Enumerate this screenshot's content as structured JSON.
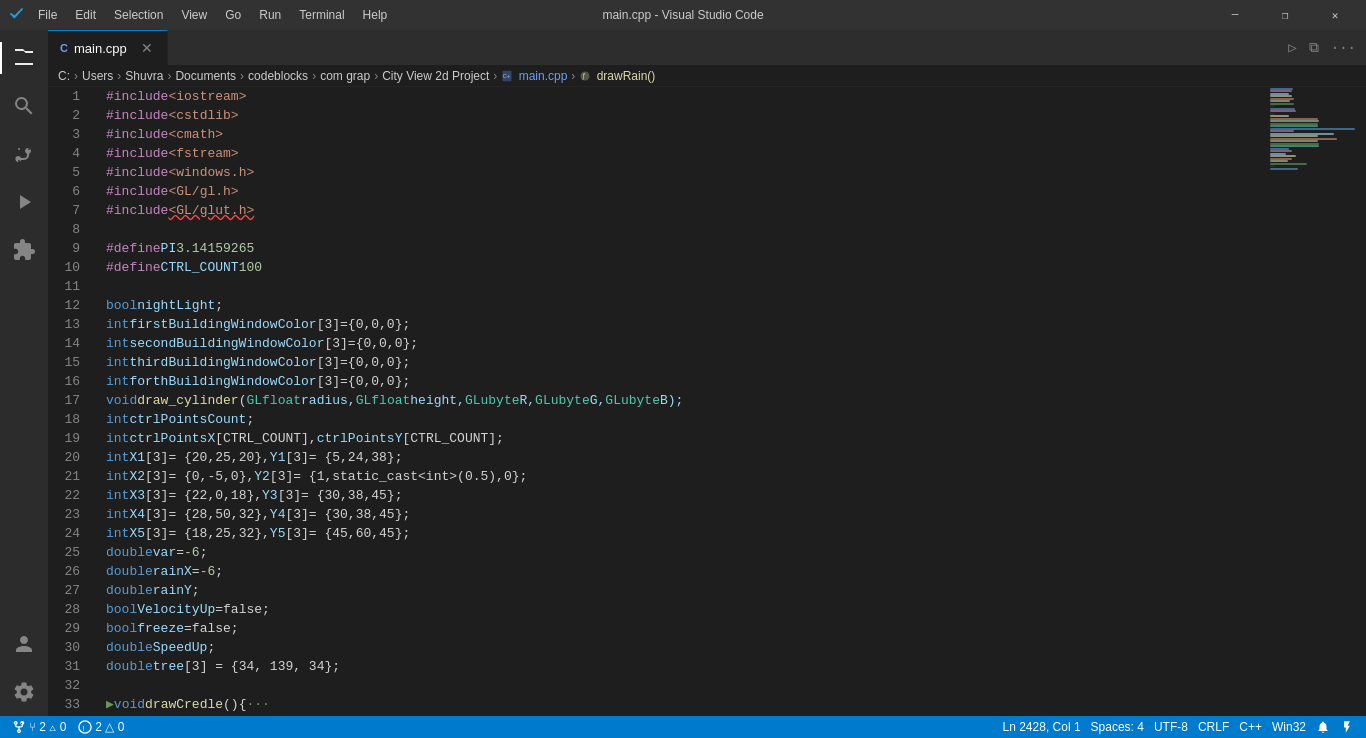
{
  "titleBar": {
    "menus": [
      "File",
      "Edit",
      "Selection",
      "View",
      "Go",
      "Run",
      "Terminal",
      "Help"
    ],
    "title": "main.cpp - Visual Studio Code",
    "controls": {
      "minimize": "─",
      "restore": "❐",
      "close": "✕"
    }
  },
  "activityBar": {
    "icons": [
      {
        "name": "explorer-icon",
        "symbol": "⎇",
        "label": "Explorer",
        "active": true
      },
      {
        "name": "search-icon",
        "symbol": "🔍",
        "label": "Search",
        "active": false
      },
      {
        "name": "source-control-icon",
        "symbol": "⑂",
        "label": "Source Control",
        "active": false
      },
      {
        "name": "run-icon",
        "symbol": "▷",
        "label": "Run",
        "active": false
      },
      {
        "name": "extensions-icon",
        "symbol": "⊞",
        "label": "Extensions",
        "active": false
      }
    ],
    "bottomIcons": [
      {
        "name": "account-icon",
        "symbol": "👤",
        "label": "Account"
      },
      {
        "name": "settings-icon",
        "symbol": "⚙",
        "label": "Settings"
      }
    ]
  },
  "tabs": [
    {
      "label": "main.cpp",
      "icon": "C++-file",
      "active": true,
      "modified": false
    }
  ],
  "tabActions": [
    {
      "name": "run-button",
      "symbol": "▷"
    },
    {
      "name": "split-editor-button",
      "symbol": "⧉"
    },
    {
      "name": "more-actions-button",
      "symbol": "···"
    }
  ],
  "breadcrumb": [
    {
      "text": "C:",
      "type": "normal"
    },
    {
      "text": ">",
      "type": "sep"
    },
    {
      "text": "Users",
      "type": "normal"
    },
    {
      "text": ">",
      "type": "sep"
    },
    {
      "text": "Shuvra",
      "type": "normal"
    },
    {
      "text": ">",
      "type": "sep"
    },
    {
      "text": "Documents",
      "type": "normal"
    },
    {
      "text": ">",
      "type": "sep"
    },
    {
      "text": "codeblocks",
      "type": "normal"
    },
    {
      "text": ">",
      "type": "sep"
    },
    {
      "text": "com grap",
      "type": "normal"
    },
    {
      "text": ">",
      "type": "sep"
    },
    {
      "text": "City View 2d Project",
      "type": "normal"
    },
    {
      "text": ">",
      "type": "sep"
    },
    {
      "text": "main.cpp",
      "type": "file"
    },
    {
      "text": ">",
      "type": "sep"
    },
    {
      "text": "drawRain()",
      "type": "func"
    }
  ],
  "codeLines": [
    {
      "num": 1,
      "tokens": [
        {
          "t": "#include ",
          "c": "kw-include"
        },
        {
          "t": "<iostream>",
          "c": "str-include"
        }
      ]
    },
    {
      "num": 2,
      "tokens": [
        {
          "t": "#include ",
          "c": "kw-include"
        },
        {
          "t": "<cstdlib>",
          "c": "str-include"
        }
      ]
    },
    {
      "num": 3,
      "tokens": [
        {
          "t": "#include ",
          "c": "kw-include"
        },
        {
          "t": "<cmath>",
          "c": "str-include"
        }
      ]
    },
    {
      "num": 4,
      "tokens": [
        {
          "t": "#include ",
          "c": "kw-include"
        },
        {
          "t": "<fstream>",
          "c": "str-include"
        }
      ]
    },
    {
      "num": 5,
      "tokens": [
        {
          "t": "#include ",
          "c": "kw-include"
        },
        {
          "t": "<windows.h>",
          "c": "str-include"
        }
      ]
    },
    {
      "num": 6,
      "tokens": [
        {
          "t": "#include",
          "c": "kw-include"
        },
        {
          "t": "<GL/gl.h>",
          "c": "str-include"
        }
      ]
    },
    {
      "num": 7,
      "tokens": [
        {
          "t": "#include ",
          "c": "kw-include"
        },
        {
          "t": "<GL/glut.h>",
          "c": "str-include squiggly"
        }
      ]
    },
    {
      "num": 8,
      "tokens": []
    },
    {
      "num": 9,
      "tokens": [
        {
          "t": "#define ",
          "c": "kw-define"
        },
        {
          "t": "PI ",
          "c": "macro-name"
        },
        {
          "t": "3.14159265",
          "c": "macro-val"
        }
      ]
    },
    {
      "num": 10,
      "tokens": [
        {
          "t": "#define ",
          "c": "kw-define"
        },
        {
          "t": "CTRL_COUNT ",
          "c": "macro-name"
        },
        {
          "t": "100",
          "c": "macro-val"
        }
      ]
    },
    {
      "num": 11,
      "tokens": []
    },
    {
      "num": 12,
      "tokens": [
        {
          "t": "bool ",
          "c": "kw-bool"
        },
        {
          "t": "nightLight",
          "c": "var-name"
        },
        {
          "t": ";",
          "c": "punct"
        }
      ]
    },
    {
      "num": 13,
      "tokens": [
        {
          "t": "int ",
          "c": "kw-int"
        },
        {
          "t": "firstBuildingWindowColor",
          "c": "var-name"
        },
        {
          "t": "[3]={0,0,0};",
          "c": "punct"
        }
      ]
    },
    {
      "num": 14,
      "tokens": [
        {
          "t": "int ",
          "c": "kw-int"
        },
        {
          "t": "secondBuildingWindowColor",
          "c": "var-name"
        },
        {
          "t": "[3]={0,0,0};",
          "c": "punct"
        }
      ]
    },
    {
      "num": 15,
      "tokens": [
        {
          "t": "int ",
          "c": "kw-int"
        },
        {
          "t": "thirdBuildingWindowColor",
          "c": "var-name"
        },
        {
          "t": "[3]={0,0,0};",
          "c": "punct"
        }
      ]
    },
    {
      "num": 16,
      "tokens": [
        {
          "t": "int ",
          "c": "kw-int"
        },
        {
          "t": "forthBuildingWindowColor",
          "c": "var-name"
        },
        {
          "t": "[3]={0,0,0};",
          "c": "punct"
        }
      ]
    },
    {
      "num": 17,
      "tokens": [
        {
          "t": "void ",
          "c": "kw-void"
        },
        {
          "t": "draw_cylinder",
          "c": "func-name"
        },
        {
          "t": "(",
          "c": "punct"
        },
        {
          "t": "GLfloat ",
          "c": "param-type"
        },
        {
          "t": "radius, ",
          "c": "var-name"
        },
        {
          "t": "GLfloat ",
          "c": "param-type"
        },
        {
          "t": "height, ",
          "c": "var-name"
        },
        {
          "t": "GLubyte ",
          "c": "param-type"
        },
        {
          "t": "R, ",
          "c": "var-name"
        },
        {
          "t": "GLubyte ",
          "c": "param-type"
        },
        {
          "t": "G, ",
          "c": "var-name"
        },
        {
          "t": "GLubyte ",
          "c": "param-type"
        },
        {
          "t": "B);",
          "c": "var-name"
        }
      ]
    },
    {
      "num": 18,
      "tokens": [
        {
          "t": "int ",
          "c": "kw-int"
        },
        {
          "t": "ctrlPointsCount",
          "c": "var-name"
        },
        {
          "t": ";",
          "c": "punct"
        }
      ]
    },
    {
      "num": 19,
      "tokens": [
        {
          "t": "int ",
          "c": "kw-int"
        },
        {
          "t": "ctrlPointsX",
          "c": "var-name"
        },
        {
          "t": "[CTRL_COUNT], ",
          "c": "punct"
        },
        {
          "t": "ctrlPointsY",
          "c": "var-name"
        },
        {
          "t": "[CTRL_COUNT];",
          "c": "punct"
        }
      ]
    },
    {
      "num": 20,
      "tokens": [
        {
          "t": "int ",
          "c": "kw-int"
        },
        {
          "t": "X1",
          "c": "var-name"
        },
        {
          "t": "[3]= {20,25,20}, ",
          "c": "punct"
        },
        {
          "t": "Y1",
          "c": "var-name"
        },
        {
          "t": "[3]= {5,24,38};",
          "c": "punct"
        }
      ]
    },
    {
      "num": 21,
      "tokens": [
        {
          "t": "int ",
          "c": "kw-int"
        },
        {
          "t": "X2",
          "c": "var-name"
        },
        {
          "t": "[3]= {0,-5,0}, ",
          "c": "punct"
        },
        {
          "t": "Y2",
          "c": "var-name"
        },
        {
          "t": "[3]= {1,static_cast<int>(0.5),0};",
          "c": "punct"
        }
      ]
    },
    {
      "num": 22,
      "tokens": [
        {
          "t": "int ",
          "c": "kw-int"
        },
        {
          "t": "X3",
          "c": "var-name"
        },
        {
          "t": "[3]= {22,0,18}, ",
          "c": "punct"
        },
        {
          "t": "Y3",
          "c": "var-name"
        },
        {
          "t": "[3]= {30,38,45};",
          "c": "punct"
        }
      ]
    },
    {
      "num": 23,
      "tokens": [
        {
          "t": "int ",
          "c": "kw-int"
        },
        {
          "t": "X4",
          "c": "var-name"
        },
        {
          "t": "[3]= {28,50,32}, ",
          "c": "punct"
        },
        {
          "t": "Y4",
          "c": "var-name"
        },
        {
          "t": "[3]= {30,38,45};",
          "c": "punct"
        }
      ]
    },
    {
      "num": 24,
      "tokens": [
        {
          "t": "int ",
          "c": "kw-int"
        },
        {
          "t": "X5",
          "c": "var-name"
        },
        {
          "t": "[3]= {18,25,32}, ",
          "c": "punct"
        },
        {
          "t": "Y5",
          "c": "var-name"
        },
        {
          "t": "[3]= {45,60,45};",
          "c": "punct"
        }
      ]
    },
    {
      "num": 25,
      "tokens": [
        {
          "t": "double ",
          "c": "kw-double"
        },
        {
          "t": "var",
          "c": "var-name"
        },
        {
          "t": " = ",
          "c": "op"
        },
        {
          "t": "-6",
          "c": "num-val"
        },
        {
          "t": ";",
          "c": "punct"
        }
      ]
    },
    {
      "num": 26,
      "tokens": [
        {
          "t": "double ",
          "c": "kw-double"
        },
        {
          "t": "rainX",
          "c": "var-name"
        },
        {
          "t": " = ",
          "c": "op"
        },
        {
          "t": "-6",
          "c": "num-val"
        },
        {
          "t": ";",
          "c": "punct"
        }
      ]
    },
    {
      "num": 27,
      "tokens": [
        {
          "t": "double ",
          "c": "kw-double"
        },
        {
          "t": "rainY",
          "c": "var-name"
        },
        {
          "t": ";",
          "c": "punct"
        }
      ]
    },
    {
      "num": 28,
      "tokens": [
        {
          "t": "bool ",
          "c": "kw-bool"
        },
        {
          "t": "VelocityUp",
          "c": "var-name"
        },
        {
          "t": "=false;",
          "c": "punct"
        }
      ]
    },
    {
      "num": 29,
      "tokens": [
        {
          "t": "bool ",
          "c": "kw-bool"
        },
        {
          "t": "freeze",
          "c": "var-name"
        },
        {
          "t": "=false;",
          "c": "punct"
        }
      ]
    },
    {
      "num": 30,
      "tokens": [
        {
          "t": "double ",
          "c": "kw-double"
        },
        {
          "t": "SpeedUp",
          "c": "var-name"
        },
        {
          "t": ";",
          "c": "punct"
        }
      ]
    },
    {
      "num": 31,
      "tokens": [
        {
          "t": "double ",
          "c": "kw-double"
        },
        {
          "t": "tree",
          "c": "var-name"
        },
        {
          "t": "[3] = {34, 139, 34};",
          "c": "punct"
        }
      ]
    },
    {
      "num": 32,
      "tokens": []
    },
    {
      "num": 33,
      "tokens": [
        {
          "t": "▶ ",
          "c": "comment"
        },
        {
          "t": "void ",
          "c": "kw-void"
        },
        {
          "t": "drawCredle",
          "c": "func-name"
        },
        {
          "t": "(){",
          "c": "punct"
        },
        {
          "t": "···",
          "c": "comment"
        }
      ],
      "collapsed": true
    }
  ],
  "statusBar": {
    "left": [
      {
        "name": "git-branch",
        "text": "⑂ 2 △ 0"
      },
      {
        "name": "errors",
        "text": "⚠ 2 △ 0"
      }
    ],
    "right": [
      {
        "name": "cursor-pos",
        "text": "Ln 2428, Col 1"
      },
      {
        "name": "spaces",
        "text": "Spaces: 4"
      },
      {
        "name": "encoding",
        "text": "UTF-8"
      },
      {
        "name": "line-ending",
        "text": "CRLF"
      },
      {
        "name": "language",
        "text": "C++"
      },
      {
        "name": "platform",
        "text": "Win32"
      },
      {
        "name": "notifications-bell",
        "text": "🔔"
      },
      {
        "name": "remote",
        "text": "⚡"
      }
    ]
  },
  "minimap": {
    "visible": true
  }
}
